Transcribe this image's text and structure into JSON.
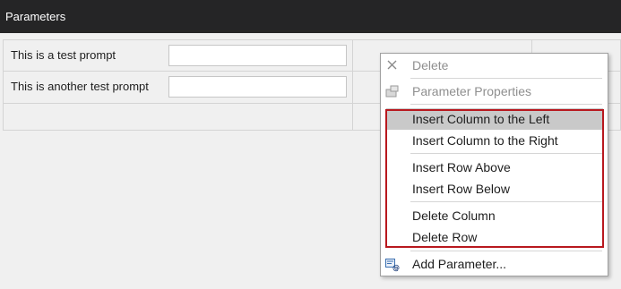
{
  "window": {
    "title": "Parameters"
  },
  "grid": {
    "rows": [
      {
        "prompt": "This is a test prompt"
      },
      {
        "prompt": "This is another test prompt"
      }
    ]
  },
  "context_menu": {
    "delete": {
      "label": "Delete",
      "icon": "x-icon",
      "enabled": false
    },
    "properties": {
      "label": "Parameter Properties",
      "icon": "properties-icon",
      "enabled": false
    },
    "insert_col_left": {
      "label": "Insert Column to the Left"
    },
    "insert_col_right": {
      "label": "Insert Column to the Right"
    },
    "insert_row_above": {
      "label": "Insert Row Above"
    },
    "insert_row_below": {
      "label": "Insert Row Below"
    },
    "delete_column": {
      "label": "Delete Column"
    },
    "delete_row": {
      "label": "Delete Row"
    },
    "add_parameter": {
      "label": "Add Parameter...",
      "icon": "add-parameter-icon"
    }
  },
  "colors": {
    "titlebar": "#252526",
    "highlight_border": "#b8181e",
    "hover": "#c9c9c9"
  }
}
